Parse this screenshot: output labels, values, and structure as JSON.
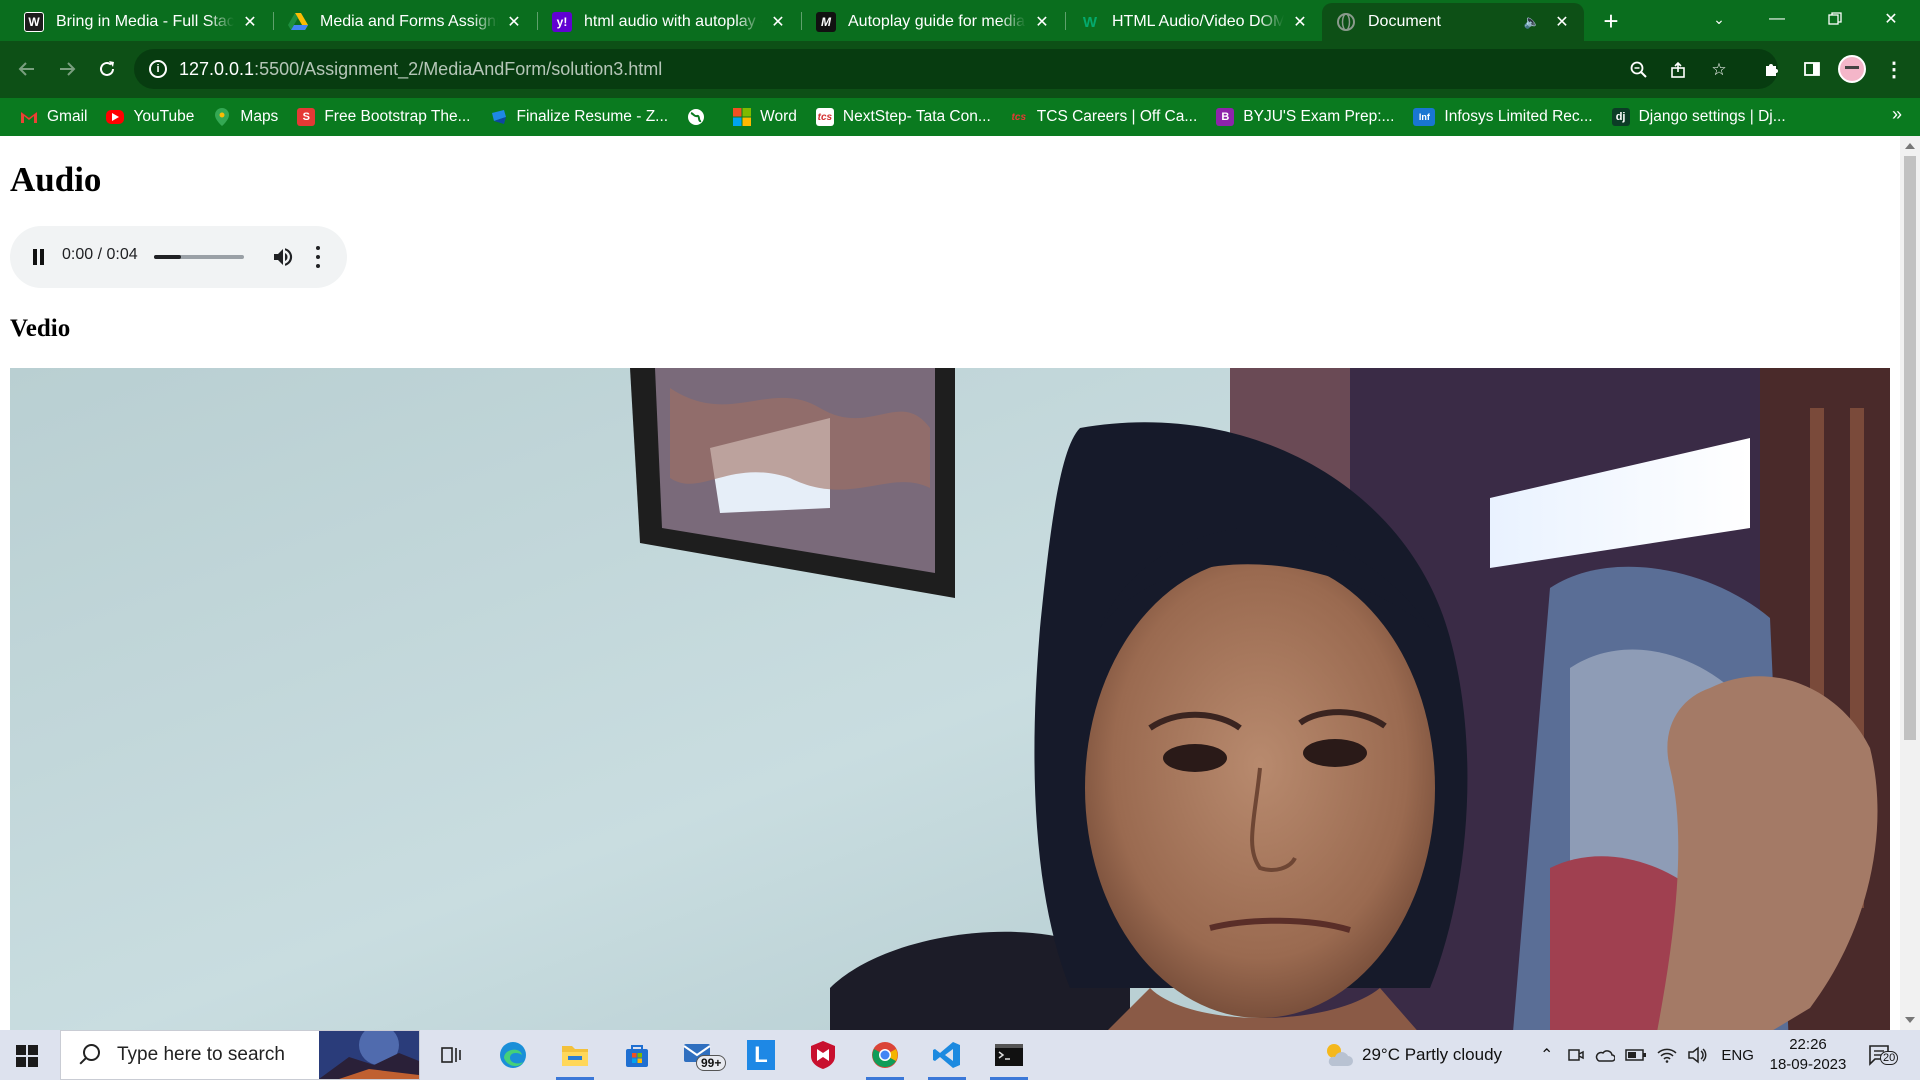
{
  "browser": {
    "tabs": [
      {
        "title": "Bring in Media - Full Stack",
        "favicon": "wordpress-favicon"
      },
      {
        "title": "Media and Forms Assignm",
        "favicon": "google-drive-favicon"
      },
      {
        "title": "html audio with autoplay -",
        "favicon": "yahoo-favicon"
      },
      {
        "title": "Autoplay guide for media a",
        "favicon": "mdn-favicon"
      },
      {
        "title": "HTML Audio/Video DOM R",
        "favicon": "w3schools-favicon"
      },
      {
        "title": "Document",
        "favicon": "globe-favicon",
        "active": true,
        "playing_audio": true
      }
    ],
    "url_host": "127.0.0.1",
    "url_rest": ":5500/Assignment_2/MediaAndForm/solution3.html",
    "bookmarks": [
      {
        "label": "Gmail",
        "icon": "gmail-icon",
        "color": "#ea4335"
      },
      {
        "label": "YouTube",
        "icon": "youtube-icon",
        "color": "#ff0000"
      },
      {
        "label": "Maps",
        "icon": "maps-icon",
        "color": "#34a853"
      },
      {
        "label": "Free Bootstrap The...",
        "icon": "s-icon",
        "color": "#e53935"
      },
      {
        "label": "Finalize Resume - Z...",
        "icon": "zety-icon",
        "color": "#1e88e5"
      },
      {
        "label": "",
        "icon": "globe-icon",
        "color": "#ffffff"
      },
      {
        "label": "Word",
        "icon": "microsoft-icon",
        "color": "#f25022"
      },
      {
        "label": "NextStep- Tata Con...",
        "icon": "tcs-icon",
        "color": "#d32f2f"
      },
      {
        "label": "TCS Careers | Off Ca...",
        "icon": "tcs-icon",
        "color": "#d32f2f"
      },
      {
        "label": "BYJU'S Exam Prep:...",
        "icon": "byjus-icon",
        "color": "#8e24aa"
      },
      {
        "label": "Infosys Limited Rec...",
        "icon": "infosys-icon",
        "color": "#1976d2"
      },
      {
        "label": "Django settings | Dj...",
        "icon": "django-icon",
        "color": "#0c3c26"
      }
    ]
  },
  "page": {
    "audio_heading": "Audio",
    "audio_player": {
      "time": "0:00 / 0:04",
      "state": "playing",
      "volume_level": 0.3
    },
    "video_heading": "Vedio",
    "video": {
      "content": "webcam-feed"
    }
  },
  "taskbar": {
    "search_placeholder": "Type here to search",
    "apps": [
      "task-view-icon",
      "edge-icon",
      "file-explorer-icon",
      "store-icon",
      "mail-icon",
      "l-app-icon",
      "mcafee-icon",
      "chrome-icon",
      "vscode-icon",
      "terminal-icon"
    ],
    "mail_badge": "99+",
    "weather": "29°C  Partly cloudy",
    "language": "ENG",
    "time": "22:26",
    "date": "18-09-2023",
    "notification_count": "20"
  },
  "colors": {
    "tabstrip": "#0a6e1e",
    "toolbar": "#0d5016",
    "bookmarks_bar": "#0a7a1f",
    "taskbar": "#dde2ee"
  }
}
